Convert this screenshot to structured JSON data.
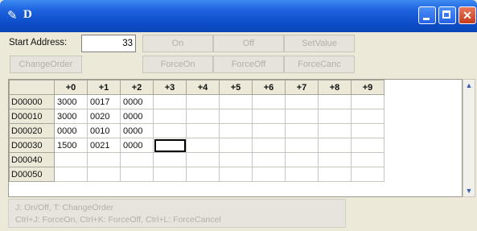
{
  "window": {
    "title": "D",
    "icon": "pencil-icon"
  },
  "toolbar": {
    "start_address_label": "Start Address:",
    "start_address_value": "33",
    "buttons": {
      "on": "On",
      "off": "Off",
      "set_value": "SetValue",
      "change_order": "ChangeOrder",
      "force_on": "ForceOn",
      "force_off": "ForceOff",
      "force_canc": "ForceCanc"
    }
  },
  "grid": {
    "columns": [
      "+0",
      "+1",
      "+2",
      "+3",
      "+4",
      "+5",
      "+6",
      "+7",
      "+8",
      "+9"
    ],
    "rows": [
      {
        "addr": "D00000",
        "cells": [
          "3000",
          "0017",
          "0000",
          "",
          "",
          "",
          "",
          "",
          "",
          ""
        ]
      },
      {
        "addr": "D00010",
        "cells": [
          "3000",
          "0020",
          "0000",
          "",
          "",
          "",
          "",
          "",
          "",
          ""
        ]
      },
      {
        "addr": "D00020",
        "cells": [
          "0000",
          "0010",
          "0000",
          "",
          "",
          "",
          "",
          "",
          "",
          ""
        ]
      },
      {
        "addr": "D00030",
        "cells": [
          "1500",
          "0021",
          "0000",
          "",
          "",
          "",
          "",
          "",
          "",
          ""
        ]
      },
      {
        "addr": "D00040",
        "cells": [
          "",
          "",
          "",
          "",
          "",
          "",
          "",
          "",
          "",
          ""
        ]
      },
      {
        "addr": "D00050",
        "cells": [
          "",
          "",
          "",
          "",
          "",
          "",
          "",
          "",
          "",
          ""
        ]
      }
    ],
    "selected": {
      "row": 3,
      "col": 3
    }
  },
  "status": {
    "line1": "J: On/Off,   T: ChangeOrder",
    "line2": "Ctrl+J: ForceOn,    Ctrl+K: ForceOff,    Ctrl+L: ForceCancel"
  }
}
